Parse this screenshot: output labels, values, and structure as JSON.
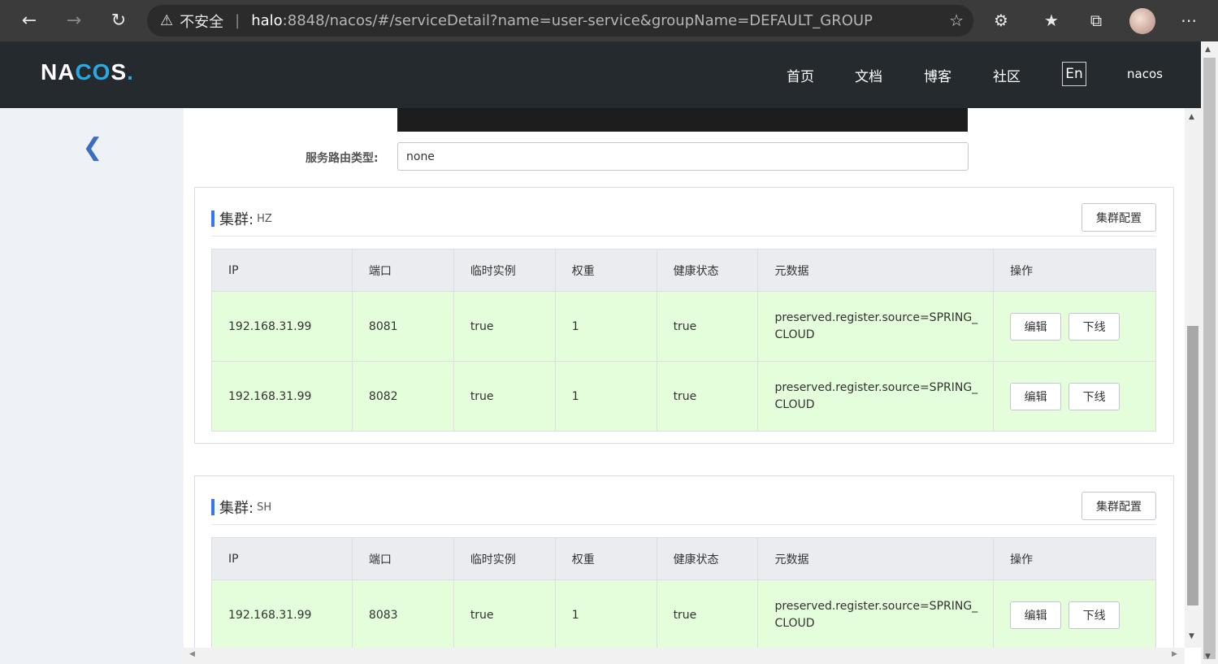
{
  "browser": {
    "security_label": "不安全",
    "url_host": "halo",
    "url_path": ":8848/nacos/#/serviceDetail?name=user-service&groupName=DEFAULT_GROUP",
    "icons": [
      "back-icon",
      "forward-icon",
      "refresh-icon",
      "warning-icon",
      "add-favorite-icon",
      "extensions-icon",
      "favorites-icon",
      "collections-icon",
      "profile-avatar",
      "more-icon"
    ]
  },
  "header": {
    "logo": {
      "part1": "NA",
      "part2": "CO",
      "part3": "S",
      "dot": "."
    },
    "nav": {
      "home": "首页",
      "docs": "文档",
      "blog": "博客",
      "community": "社区"
    },
    "lang": "En",
    "user": "nacos"
  },
  "service": {
    "route_label": "服务路由类型:",
    "route_value": "none"
  },
  "clusters": [
    {
      "title": "集群:",
      "name": "HZ",
      "config_button": "集群配置",
      "columns": [
        "IP",
        "端口",
        "临时实例",
        "权重",
        "健康状态",
        "元数据",
        "操作"
      ],
      "rows": [
        {
          "ip": "192.168.31.99",
          "port": "8081",
          "ephemeral": "true",
          "weight": "1",
          "healthy": "true",
          "metadata": "preserved.register.source=SPRING_CLOUD",
          "edit": "编辑",
          "offline": "下线"
        },
        {
          "ip": "192.168.31.99",
          "port": "8082",
          "ephemeral": "true",
          "weight": "1",
          "healthy": "true",
          "metadata": "preserved.register.source=SPRING_CLOUD",
          "edit": "编辑",
          "offline": "下线"
        }
      ]
    },
    {
      "title": "集群:",
      "name": "SH",
      "config_button": "集群配置",
      "columns": [
        "IP",
        "端口",
        "临时实例",
        "权重",
        "健康状态",
        "元数据",
        "操作"
      ],
      "rows": [
        {
          "ip": "192.168.31.99",
          "port": "8083",
          "ephemeral": "true",
          "weight": "1",
          "healthy": "true",
          "metadata": "preserved.register.source=SPRING_CLOUD",
          "edit": "编辑",
          "offline": "下线"
        }
      ]
    }
  ],
  "colors": {
    "header_bg": "#252a2f",
    "accent": "#3477f5",
    "healthy_row": "#e4fdda",
    "table_header": "#ebecf0",
    "sidebar_bg": "#eef1f5"
  }
}
